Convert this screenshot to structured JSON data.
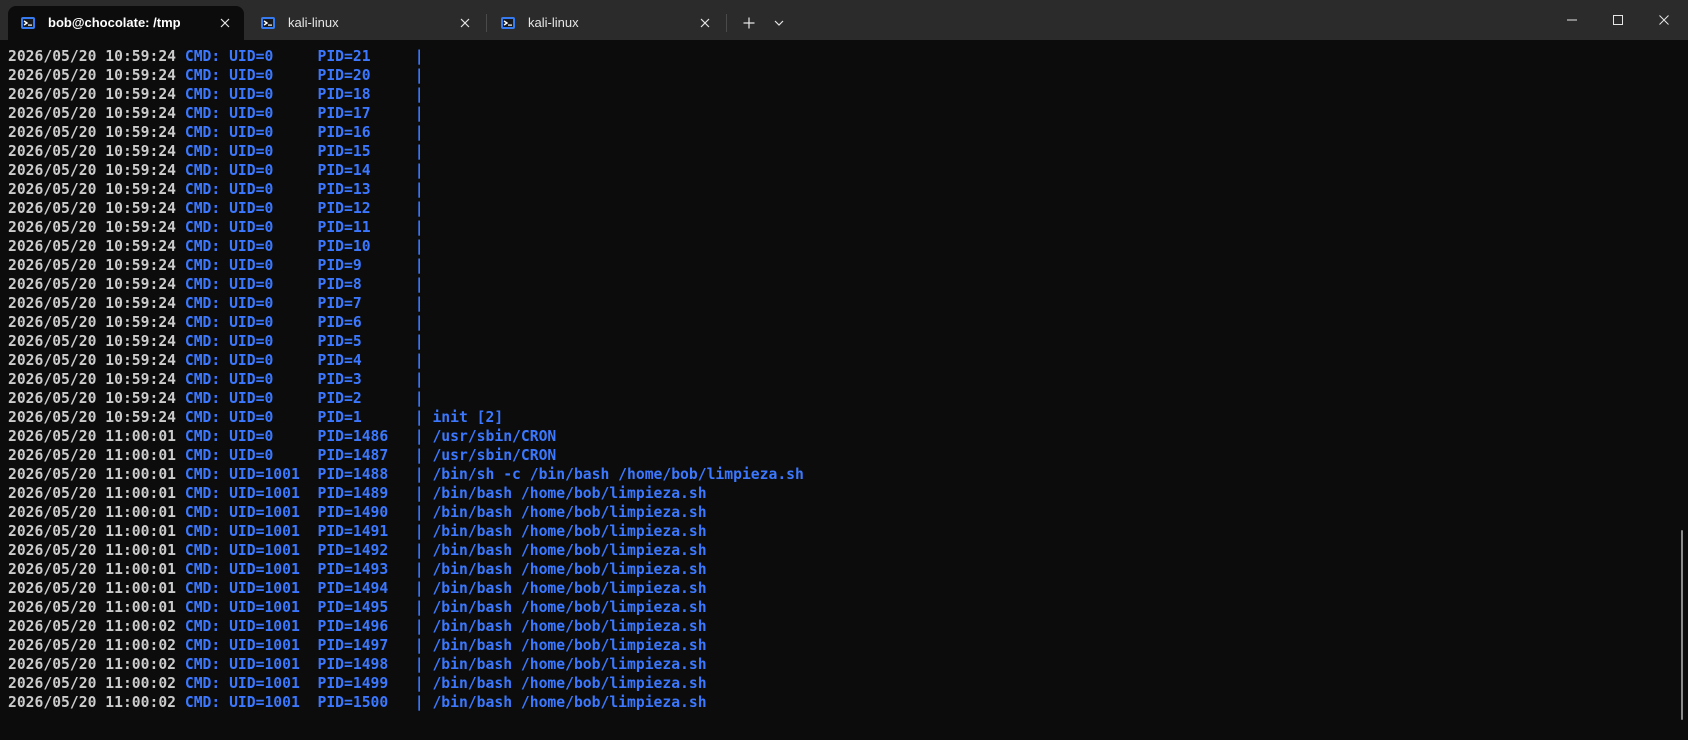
{
  "window": {
    "tabs": [
      {
        "label": "bob@chocolate: /tmp",
        "icon": "kali-terminal-icon",
        "active": true
      },
      {
        "label": "kali-linux",
        "icon": "kali-terminal-icon",
        "active": false
      },
      {
        "label": "kali-linux",
        "icon": "kali-terminal-icon",
        "active": false
      }
    ],
    "new_tab_glyph": "+",
    "dropdown_glyph": "⌄",
    "controls": {
      "minimize": "minimize-icon",
      "maximize": "maximize-icon",
      "close": "close-icon"
    }
  },
  "colors": {
    "background": "#0c0c0c",
    "titlebar": "#2b2b2b",
    "timestamp": "#cccccc",
    "accent_blue": "#3b78ff"
  },
  "terminal": {
    "lines": [
      {
        "ts": "2026/05/20 10:59:24",
        "cmd": "CMD: UID=0     PID=21     |",
        "exe": ""
      },
      {
        "ts": "2026/05/20 10:59:24",
        "cmd": "CMD: UID=0     PID=20     |",
        "exe": ""
      },
      {
        "ts": "2026/05/20 10:59:24",
        "cmd": "CMD: UID=0     PID=18     |",
        "exe": ""
      },
      {
        "ts": "2026/05/20 10:59:24",
        "cmd": "CMD: UID=0     PID=17     |",
        "exe": ""
      },
      {
        "ts": "2026/05/20 10:59:24",
        "cmd": "CMD: UID=0     PID=16     |",
        "exe": ""
      },
      {
        "ts": "2026/05/20 10:59:24",
        "cmd": "CMD: UID=0     PID=15     |",
        "exe": ""
      },
      {
        "ts": "2026/05/20 10:59:24",
        "cmd": "CMD: UID=0     PID=14     |",
        "exe": ""
      },
      {
        "ts": "2026/05/20 10:59:24",
        "cmd": "CMD: UID=0     PID=13     |",
        "exe": ""
      },
      {
        "ts": "2026/05/20 10:59:24",
        "cmd": "CMD: UID=0     PID=12     |",
        "exe": ""
      },
      {
        "ts": "2026/05/20 10:59:24",
        "cmd": "CMD: UID=0     PID=11     |",
        "exe": ""
      },
      {
        "ts": "2026/05/20 10:59:24",
        "cmd": "CMD: UID=0     PID=10     |",
        "exe": ""
      },
      {
        "ts": "2026/05/20 10:59:24",
        "cmd": "CMD: UID=0     PID=9      |",
        "exe": ""
      },
      {
        "ts": "2026/05/20 10:59:24",
        "cmd": "CMD: UID=0     PID=8      |",
        "exe": ""
      },
      {
        "ts": "2026/05/20 10:59:24",
        "cmd": "CMD: UID=0     PID=7      |",
        "exe": ""
      },
      {
        "ts": "2026/05/20 10:59:24",
        "cmd": "CMD: UID=0     PID=6      |",
        "exe": ""
      },
      {
        "ts": "2026/05/20 10:59:24",
        "cmd": "CMD: UID=0     PID=5      |",
        "exe": ""
      },
      {
        "ts": "2026/05/20 10:59:24",
        "cmd": "CMD: UID=0     PID=4      |",
        "exe": ""
      },
      {
        "ts": "2026/05/20 10:59:24",
        "cmd": "CMD: UID=0     PID=3      |",
        "exe": ""
      },
      {
        "ts": "2026/05/20 10:59:24",
        "cmd": "CMD: UID=0     PID=2      |",
        "exe": ""
      },
      {
        "ts": "2026/05/20 10:59:24",
        "cmd": "CMD: UID=0     PID=1      |",
        "exe": "init [2]"
      },
      {
        "ts": "2026/05/20 11:00:01",
        "cmd": "CMD: UID=0     PID=1486   |",
        "exe": "/usr/sbin/CRON"
      },
      {
        "ts": "2026/05/20 11:00:01",
        "cmd": "CMD: UID=0     PID=1487   |",
        "exe": "/usr/sbin/CRON"
      },
      {
        "ts": "2026/05/20 11:00:01",
        "cmd": "CMD: UID=1001  PID=1488   |",
        "exe": "/bin/sh -c /bin/bash /home/bob/limpieza.sh"
      },
      {
        "ts": "2026/05/20 11:00:01",
        "cmd": "CMD: UID=1001  PID=1489   |",
        "exe": "/bin/bash /home/bob/limpieza.sh"
      },
      {
        "ts": "2026/05/20 11:00:01",
        "cmd": "CMD: UID=1001  PID=1490   |",
        "exe": "/bin/bash /home/bob/limpieza.sh"
      },
      {
        "ts": "2026/05/20 11:00:01",
        "cmd": "CMD: UID=1001  PID=1491   |",
        "exe": "/bin/bash /home/bob/limpieza.sh"
      },
      {
        "ts": "2026/05/20 11:00:01",
        "cmd": "CMD: UID=1001  PID=1492   |",
        "exe": "/bin/bash /home/bob/limpieza.sh"
      },
      {
        "ts": "2026/05/20 11:00:01",
        "cmd": "CMD: UID=1001  PID=1493   |",
        "exe": "/bin/bash /home/bob/limpieza.sh"
      },
      {
        "ts": "2026/05/20 11:00:01",
        "cmd": "CMD: UID=1001  PID=1494   |",
        "exe": "/bin/bash /home/bob/limpieza.sh"
      },
      {
        "ts": "2026/05/20 11:00:01",
        "cmd": "CMD: UID=1001  PID=1495   |",
        "exe": "/bin/bash /home/bob/limpieza.sh"
      },
      {
        "ts": "2026/05/20 11:00:02",
        "cmd": "CMD: UID=1001  PID=1496   |",
        "exe": "/bin/bash /home/bob/limpieza.sh"
      },
      {
        "ts": "2026/05/20 11:00:02",
        "cmd": "CMD: UID=1001  PID=1497   |",
        "exe": "/bin/bash /home/bob/limpieza.sh"
      },
      {
        "ts": "2026/05/20 11:00:02",
        "cmd": "CMD: UID=1001  PID=1498   |",
        "exe": "/bin/bash /home/bob/limpieza.sh"
      },
      {
        "ts": "2026/05/20 11:00:02",
        "cmd": "CMD: UID=1001  PID=1499   |",
        "exe": "/bin/bash /home/bob/limpieza.sh"
      },
      {
        "ts": "2026/05/20 11:00:02",
        "cmd": "CMD: UID=1001  PID=1500   |",
        "exe": "/bin/bash /home/bob/limpieza.sh"
      }
    ]
  }
}
